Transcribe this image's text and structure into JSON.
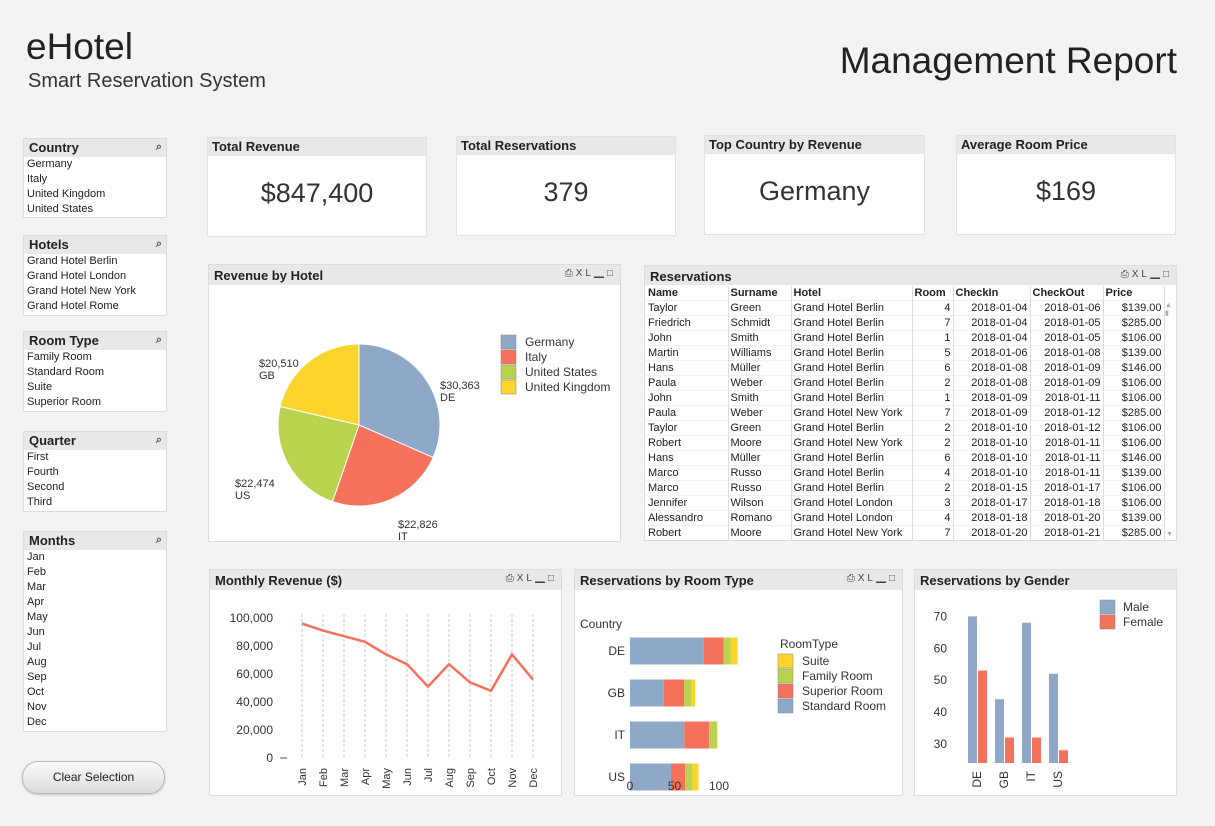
{
  "header": {
    "app_title": "eHotel",
    "app_subtitle": "Smart Reservation System",
    "report_title": "Management Report"
  },
  "filters": {
    "country": {
      "title": "Country",
      "items": [
        "Germany",
        "Italy",
        "United Kingdom",
        "United States"
      ]
    },
    "hotels": {
      "title": "Hotels",
      "items": [
        "Grand Hotel Berlin",
        "Grand Hotel London",
        "Grand Hotel New York",
        "Grand Hotel Rome"
      ]
    },
    "room_type": {
      "title": "Room Type",
      "items": [
        "Family Room",
        "Standard Room",
        "Suite",
        "Superior Room"
      ]
    },
    "quarter": {
      "title": "Quarter",
      "items": [
        "First",
        "Fourth",
        "Second",
        "Third"
      ]
    },
    "months": {
      "title": "Months",
      "items": [
        "Jan",
        "Feb",
        "Mar",
        "Apr",
        "May",
        "Jun",
        "Jul",
        "Aug",
        "Sep",
        "Oct",
        "Nov",
        "Dec"
      ]
    }
  },
  "clear_button": "Clear Selection",
  "kpis": [
    {
      "label": "Total Revenue",
      "value": "$847,400"
    },
    {
      "label": "Total Reservations",
      "value": "379"
    },
    {
      "label": "Top Country by Revenue",
      "value": "Germany"
    },
    {
      "label": "Average Room Price",
      "value": "$169"
    }
  ],
  "tool_labels": {
    "print": "⎙",
    "xl": "XL",
    "min": "▁",
    "max": "□"
  },
  "icons": {
    "search": "magnifier-icon"
  },
  "reservations": {
    "title": "Reservations",
    "columns": [
      "Name",
      "Surname",
      "Hotel",
      "Room",
      "CheckIn",
      "CheckOut",
      "Price"
    ],
    "rows": [
      [
        "Taylor",
        "Green",
        "Grand Hotel Berlin",
        "4",
        "2018-01-04",
        "2018-01-06",
        "$139.00"
      ],
      [
        "Friedrich",
        "Schmidt",
        "Grand Hotel Berlin",
        "7",
        "2018-01-04",
        "2018-01-05",
        "$285.00"
      ],
      [
        "John",
        "Smith",
        "Grand Hotel Berlin",
        "1",
        "2018-01-04",
        "2018-01-05",
        "$106.00"
      ],
      [
        "Martin",
        "Williams",
        "Grand Hotel Berlin",
        "5",
        "2018-01-06",
        "2018-01-08",
        "$139.00"
      ],
      [
        "Hans",
        "Müller",
        "Grand Hotel Berlin",
        "6",
        "2018-01-08",
        "2018-01-09",
        "$146.00"
      ],
      [
        "Paula",
        "Weber",
        "Grand Hotel Berlin",
        "2",
        "2018-01-08",
        "2018-01-09",
        "$106.00"
      ],
      [
        "John",
        "Smith",
        "Grand Hotel Berlin",
        "1",
        "2018-01-09",
        "2018-01-11",
        "$106.00"
      ],
      [
        "Paula",
        "Weber",
        "Grand Hotel New York",
        "7",
        "2018-01-09",
        "2018-01-12",
        "$285.00"
      ],
      [
        "Taylor",
        "Green",
        "Grand Hotel Berlin",
        "2",
        "2018-01-10",
        "2018-01-12",
        "$106.00"
      ],
      [
        "Robert",
        "Moore",
        "Grand Hotel New York",
        "2",
        "2018-01-10",
        "2018-01-11",
        "$106.00"
      ],
      [
        "Hans",
        "Müller",
        "Grand Hotel Berlin",
        "6",
        "2018-01-10",
        "2018-01-11",
        "$146.00"
      ],
      [
        "Marco",
        "Russo",
        "Grand Hotel Berlin",
        "4",
        "2018-01-10",
        "2018-01-11",
        "$139.00"
      ],
      [
        "Marco",
        "Russo",
        "Grand Hotel Berlin",
        "2",
        "2018-01-15",
        "2018-01-17",
        "$106.00"
      ],
      [
        "Jennifer",
        "Wilson",
        "Grand Hotel London",
        "3",
        "2018-01-17",
        "2018-01-18",
        "$106.00"
      ],
      [
        "Alessandro",
        "Romano",
        "Grand Hotel London",
        "4",
        "2018-01-18",
        "2018-01-20",
        "$139.00"
      ],
      [
        "Robert",
        "Moore",
        "Grand Hotel New York",
        "7",
        "2018-01-20",
        "2018-01-21",
        "$285.00"
      ]
    ]
  },
  "chart_data": [
    {
      "id": "revenue_by_hotel",
      "type": "pie",
      "title": "Revenue by Hotel",
      "categories": [
        "Germany",
        "Italy",
        "United States",
        "United Kingdom"
      ],
      "values": [
        30363,
        22826,
        22474,
        20510
      ],
      "data_labels": [
        "$30,363",
        "$22,826",
        "$22,474",
        "$20,510"
      ],
      "short_labels": [
        "DE",
        "IT",
        "US",
        "GB"
      ],
      "colors": [
        "#8fa8c8",
        "#f4715c",
        "#b9d34e",
        "#fbd52c"
      ],
      "legend": "right"
    },
    {
      "id": "monthly_revenue",
      "type": "line",
      "title": "Monthly Revenue ($)",
      "x": [
        "Jan",
        "Feb",
        "Mar",
        "Apr",
        "May",
        "Jun",
        "Jul",
        "Aug",
        "Sep",
        "Oct",
        "Nov",
        "Dec"
      ],
      "values": [
        96000,
        91000,
        87000,
        83000,
        74000,
        67000,
        51000,
        67000,
        54000,
        48000,
        74000,
        56000
      ],
      "yticks": [
        0,
        20000,
        40000,
        60000,
        80000,
        100000
      ],
      "ytick_labels": [
        "0",
        "20,000",
        "40,000",
        "60,000",
        "80,000",
        "100,000"
      ],
      "ylim": [
        0,
        100000
      ],
      "grid": "vertical",
      "color": "#f4715c"
    },
    {
      "id": "room_type",
      "type": "bar",
      "orientation": "horizontal",
      "stacked": true,
      "title": "Reservations by Room Type",
      "ylabel": "Country",
      "categories": [
        "DE",
        "GB",
        "IT",
        "US"
      ],
      "series": [
        {
          "name": "Standard Room",
          "values": [
            83,
            38,
            61,
            46
          ],
          "color": "#8fa8c8"
        },
        {
          "name": "Superior Room",
          "values": [
            22,
            23,
            28,
            16
          ],
          "color": "#f4715c"
        },
        {
          "name": "Family Room",
          "values": [
            8,
            8,
            9,
            8
          ],
          "color": "#b9d34e"
        },
        {
          "name": "Suite",
          "values": [
            8,
            4,
            0,
            7
          ],
          "color": "#fbd52c"
        }
      ],
      "legend_title": "RoomType",
      "legend_order": [
        "Suite",
        "Family Room",
        "Superior Room",
        "Standard Room"
      ],
      "xticks": [
        0,
        50,
        100
      ],
      "xlim": [
        0,
        100
      ],
      "legend": "right"
    },
    {
      "id": "gender",
      "type": "bar",
      "title": "Reservations by Gender",
      "categories": [
        "DE",
        "GB",
        "IT",
        "US"
      ],
      "series": [
        {
          "name": "Male",
          "values": [
            70,
            44,
            68,
            52
          ],
          "color": "#8fa8c8"
        },
        {
          "name": "Female",
          "values": [
            53,
            32,
            32,
            28
          ],
          "color": "#f4715c"
        }
      ],
      "yticks": [
        30,
        40,
        50,
        60,
        70
      ],
      "ylim": [
        24,
        72
      ],
      "legend": "top-right"
    }
  ]
}
